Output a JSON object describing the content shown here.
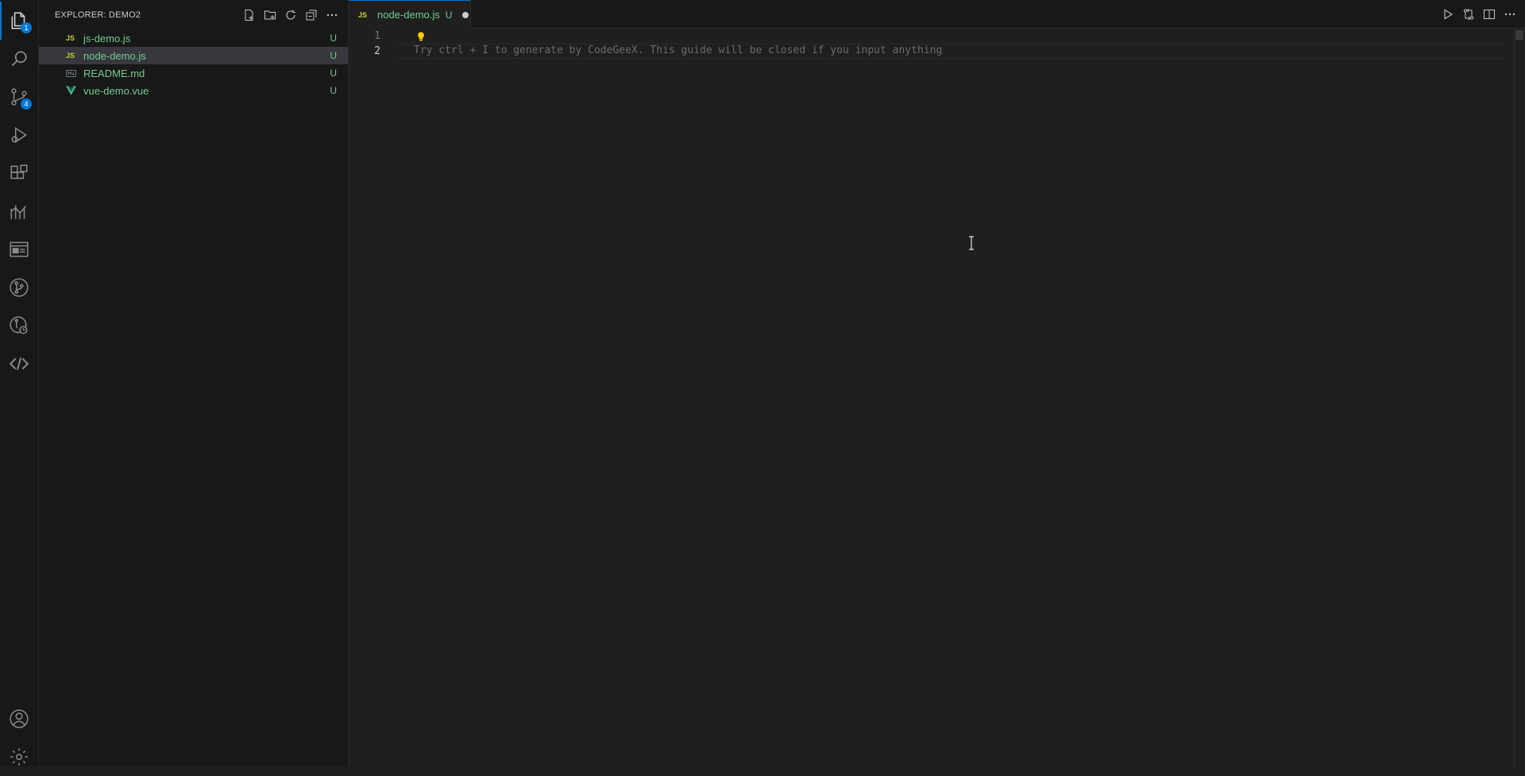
{
  "activity_bar": {
    "items": [
      {
        "name": "explorer",
        "icon": "files-icon",
        "badge": "1",
        "active": true
      },
      {
        "name": "search",
        "icon": "search-icon",
        "badge": null
      },
      {
        "name": "source-control",
        "icon": "source-control-icon",
        "badge": "4"
      },
      {
        "name": "run-debug",
        "icon": "run-debug-icon",
        "badge": null
      },
      {
        "name": "extensions",
        "icon": "extensions-icon",
        "badge": null
      },
      {
        "name": "analytics",
        "icon": "chart-icon",
        "badge": null
      },
      {
        "name": "remote-explorer",
        "icon": "window-icon",
        "badge": null
      },
      {
        "name": "git-graph",
        "icon": "git-graph-icon",
        "badge": null
      },
      {
        "name": "git-history",
        "icon": "git-history-icon",
        "badge": null
      },
      {
        "name": "codegeex",
        "icon": "code-brackets-icon",
        "badge": null
      }
    ],
    "bottom": [
      {
        "name": "accounts",
        "icon": "account-icon"
      },
      {
        "name": "manage",
        "icon": "gear-icon"
      }
    ]
  },
  "sidebar": {
    "title": "EXPLORER: DEMO2",
    "actions": [
      "new-file-icon",
      "new-folder-icon",
      "refresh-icon",
      "collapse-all-icon",
      "more-icon"
    ],
    "files": [
      {
        "name": "js-demo.js",
        "type": "JS",
        "status": "U",
        "selected": false
      },
      {
        "name": "node-demo.js",
        "type": "JS",
        "status": "U",
        "selected": true
      },
      {
        "name": "README.md",
        "type": "MD",
        "status": "U",
        "selected": false
      },
      {
        "name": "vue-demo.vue",
        "type": "V",
        "status": "U",
        "selected": false
      }
    ]
  },
  "editor": {
    "tab": {
      "name": "node-demo.js",
      "icon_label": "JS",
      "status": "U",
      "dirty": true
    },
    "actions": [
      "run-icon",
      "compare-icon",
      "split-editor-icon",
      "more-icon"
    ],
    "lines": [
      {
        "number": "1",
        "text": ""
      },
      {
        "number": "2",
        "text": ""
      }
    ],
    "ghost_text": "Try ctrl + I to generate by CodeGeeX. This guide will be closed if you input anything"
  },
  "colors": {
    "accent": "#0078d4",
    "untracked": "#73c991",
    "js_icon": "#cbcb41",
    "vue_icon": "#41b883",
    "lightbulb": "#ffcc00"
  }
}
